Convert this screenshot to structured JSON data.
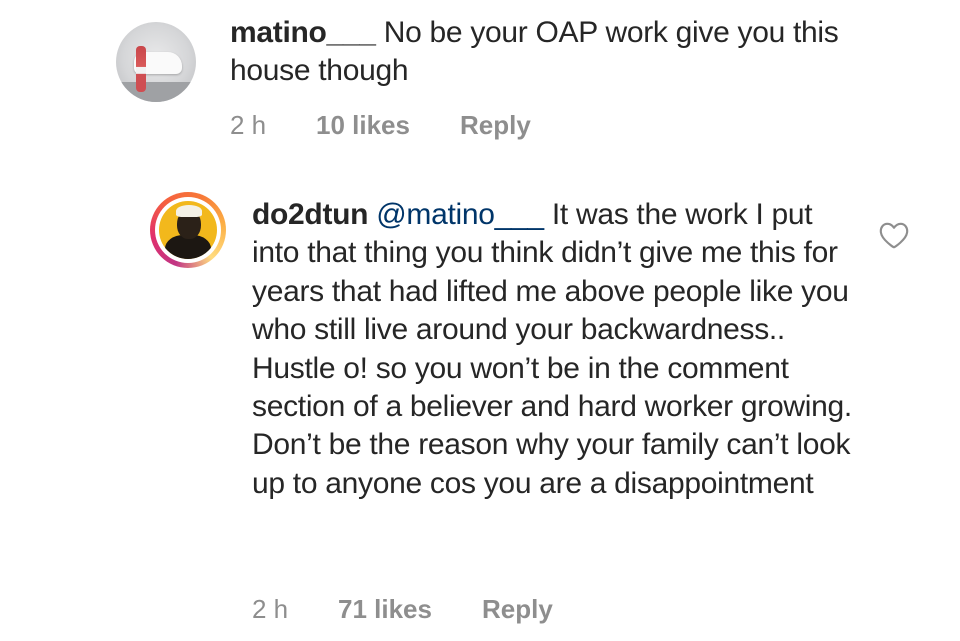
{
  "comments": [
    {
      "username": "matino___",
      "body": " No be your OAP work give you this house though",
      "time": "2 h",
      "likes": "10 likes",
      "reply_label": "Reply"
    },
    {
      "username": "do2dtun",
      "mention": "@matino___",
      "body": " It was the work I put into that thing you think didn’t give me this for years that had lifted me above people like you who still live around your backwardness.. Hustle o! so you won’t be in the comment section of a believer and hard worker growing. Don’t be the reason why your family can’t look up to anyone cos you are a disappointment",
      "time": "2 h",
      "likes": "71 likes",
      "reply_label": "Reply",
      "like_icon": "heart-outline-icon"
    }
  ],
  "colors": {
    "text": "#262626",
    "meta": "#8e8e8e",
    "mention": "#003569",
    "story_ring": [
      "#c13584",
      "#fcaf45"
    ]
  }
}
